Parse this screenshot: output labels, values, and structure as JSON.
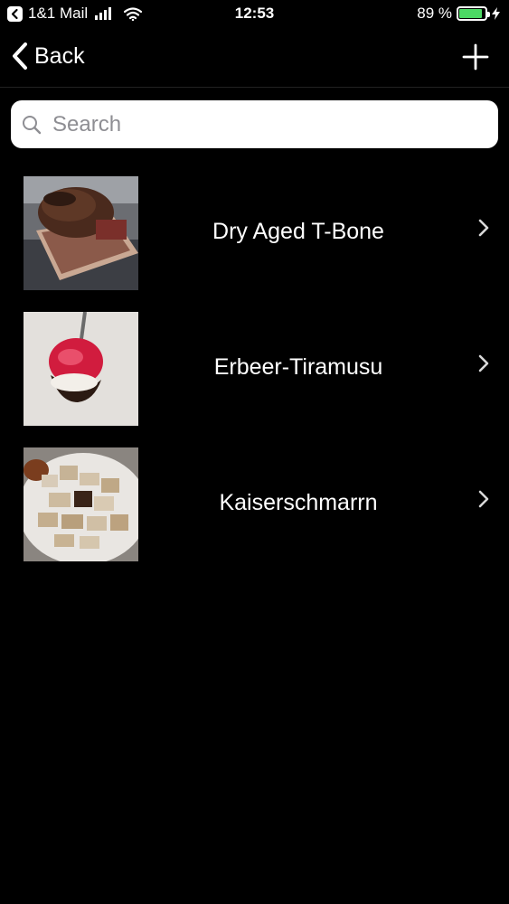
{
  "status_bar": {
    "carrier": "1&1 Mail",
    "time": "12:53",
    "battery_percent_text": "89 %",
    "battery_level": 0.89,
    "battery_color": "#4cd964",
    "icons": [
      "back-to-app-icon",
      "signal-icon",
      "wifi-icon",
      "battery-icon",
      "charging-bolt-icon"
    ]
  },
  "nav": {
    "back_label": "Back",
    "add_icon": "plus-icon"
  },
  "search": {
    "placeholder": "Search",
    "value": ""
  },
  "items": [
    {
      "label": "Dry Aged T-Bone",
      "thumbnail": "steak-photo"
    },
    {
      "label": "Erbeer-Tiramusu",
      "thumbnail": "tiramisu-spoon-photo"
    },
    {
      "label": "Kaiserschmarrn",
      "thumbnail": "kaiserschmarrn-photo"
    }
  ]
}
